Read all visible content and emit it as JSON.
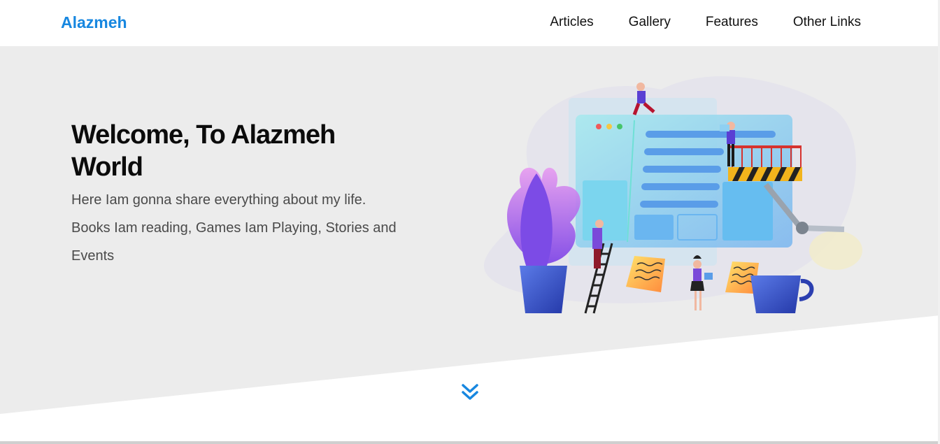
{
  "header": {
    "logo": "Alazmeh",
    "nav": [
      "Articles",
      "Gallery",
      "Features",
      "Other Links"
    ]
  },
  "hero": {
    "title": "Welcome, To Alazmeh World",
    "description": "Here Iam gonna share everything about my life. Books Iam reading, Games Iam Playing, Stories and Events",
    "illustration_icon": "website-construction-illustration"
  },
  "scroll": {
    "icon": "double-chevron-down-icon"
  },
  "colors": {
    "brand": "#1787e0",
    "hero_bg": "#ececec",
    "text_dark": "#0b0b0b",
    "text_body": "#4a4a4a"
  }
}
